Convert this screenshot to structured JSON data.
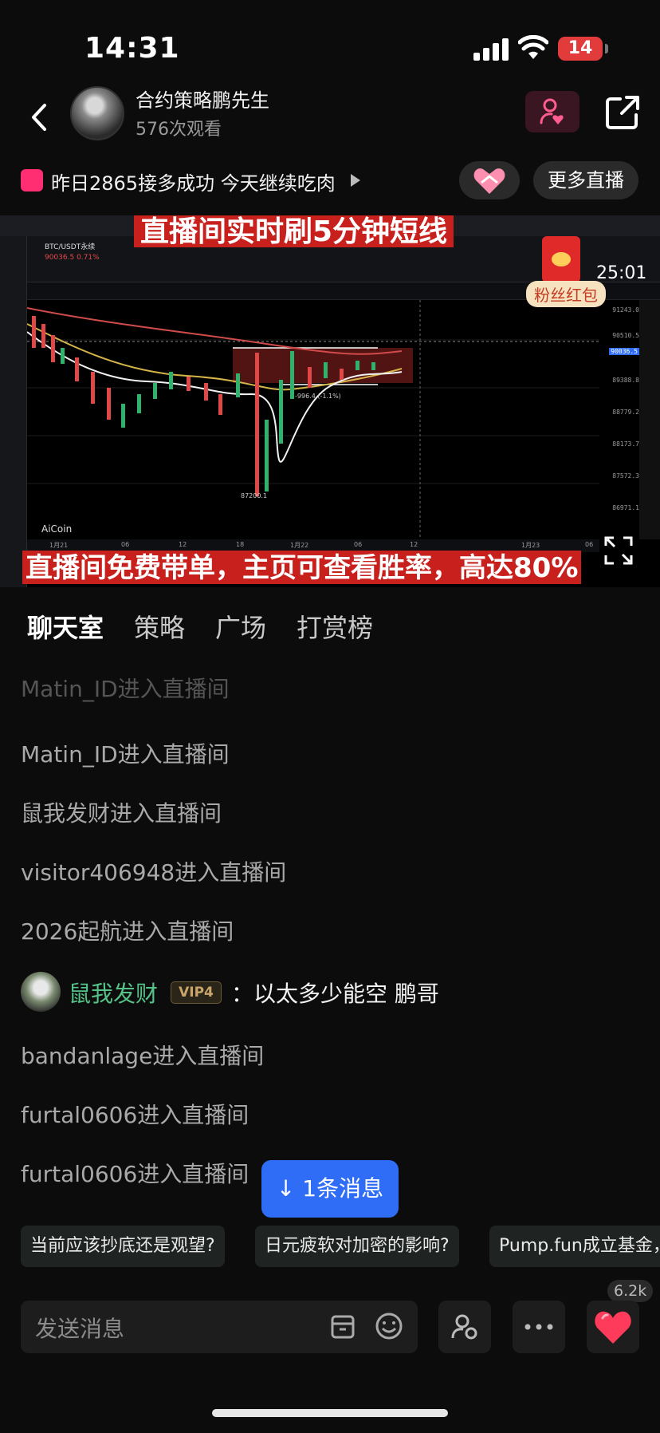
{
  "status": {
    "time": "14:31",
    "battery": "14"
  },
  "header": {
    "host_name": "合约策略鹏先生",
    "views": "576次观看"
  },
  "announcement": {
    "text": "昨日2865接多成功 今天继续吃肉",
    "more_live": "更多直播"
  },
  "video": {
    "banner_top": "直播间实时刷5分钟短线",
    "banner_bottom": "直播间免费带单，主页可查看胜率，高达80%",
    "pair": "BTC/USDT永续",
    "pair_price": "90036.5 0.71%",
    "logo": "AiCoin",
    "red_packet_label": "粉丝红包",
    "countdown": "25:01",
    "price_scale": [
      "91243.0",
      "90510.5",
      "90036.5",
      "89388.8",
      "88779.2",
      "88173.7",
      "87572.3",
      "86971.1"
    ],
    "low_marker": "87200.1",
    "range_label": "-996.4 (-1.1%)",
    "dates": [
      "1月21",
      "06",
      "12",
      "18",
      "1月22",
      "06",
      "12",
      "1月23",
      "06"
    ]
  },
  "tabs": [
    "聊天室",
    "策略",
    "广场",
    "打赏榜"
  ],
  "chat": {
    "lines": [
      "Matin_ID进入直播间",
      "Matin_ID进入直播间",
      "鼠我发财进入直播间",
      "visitor406948进入直播间",
      "2026起航进入直播间"
    ],
    "message": {
      "user": "鼠我发财",
      "vip": "VIP4",
      "text": "：以太多少能空 鹏哥"
    },
    "lines_after": [
      "bandanlage进入直播间",
      "furtal0606进入直播间",
      "furtal0606进入直播间"
    ],
    "new_messages": "1条消息"
  },
  "suggestions": [
    "当前应该抄底还是观望?",
    "日元疲软对加密的影响?",
    "Pump.fun成立基金，"
  ],
  "input": {
    "placeholder": "发送消息",
    "like_count": "6.2k"
  },
  "colors": {
    "accent_blue": "#2f6df6",
    "banner_red": "#c8201c",
    "vip_gold": "#c9a56b",
    "username_green": "#55c287"
  }
}
